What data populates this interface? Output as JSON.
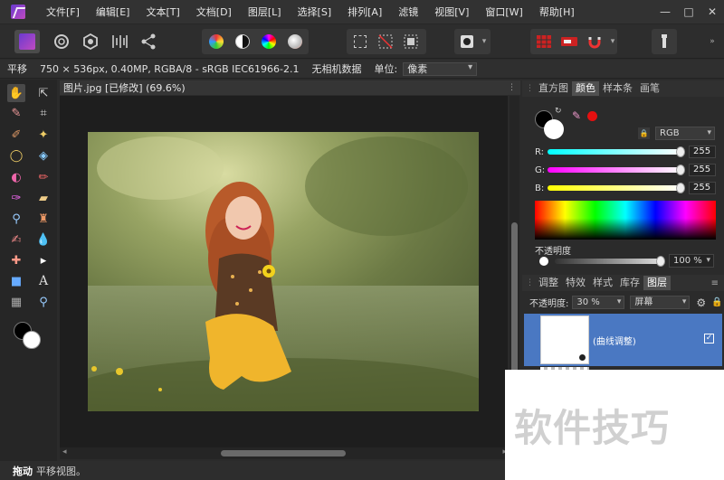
{
  "menubar": {
    "items": [
      "文件[F]",
      "编辑[E]",
      "文本[T]",
      "文档[D]",
      "图层[L]",
      "选择[S]",
      "排列[A]",
      "滤镜",
      "视图[V]",
      "窗口[W]",
      "帮助[H]"
    ],
    "minimize": "—",
    "maximize": "□",
    "close": "✕"
  },
  "context": {
    "tool": "平移",
    "info": "750 × 536px, 0.40MP, RGBA/8 - sRGB IEC61966-2.1",
    "camera": "无相机数据",
    "unit_label": "单位:",
    "unit_value": "像素"
  },
  "document": {
    "tab_title": "图片.jpg [已修改] (69.6%)"
  },
  "status": {
    "bold": "拖动",
    "text": "平移视图。"
  },
  "panel_top": {
    "tabs": [
      "直方图",
      "颜色",
      "样本条",
      "画笔"
    ],
    "active_tab": "颜色",
    "mode": "RGB",
    "r_label": "R:",
    "r_value": "255",
    "g_label": "G:",
    "g_value": "255",
    "b_label": "B:",
    "b_value": "255",
    "opacity_label": "不透明度",
    "opacity_value": "100 %"
  },
  "panel_bottom": {
    "tabs": [
      "调整",
      "特效",
      "样式",
      "库存",
      "图层"
    ],
    "active_tab": "图层",
    "opacity_label": "不透明度:",
    "opacity_value": "30 %",
    "blend_mode": "屏幕",
    "layer_name": "(曲线调整)"
  },
  "watermark": "软件技巧",
  "colors": {
    "accent": "#4a78c2",
    "record": "#e51010"
  }
}
